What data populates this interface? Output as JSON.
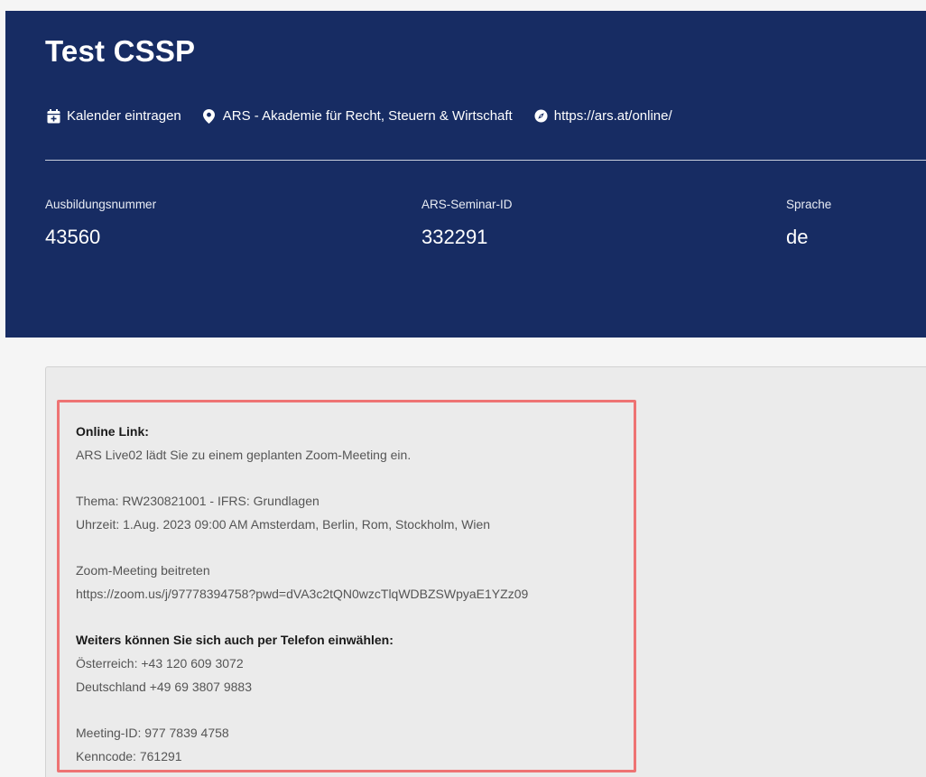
{
  "header": {
    "title": "Test CSSP",
    "calendar_label": "Kalender eintragen",
    "location_label": "ARS - Akademie für Recht, Steuern & Wirtschaft",
    "url_label": "https://ars.at/online/",
    "fields": [
      {
        "label": "Ausbildungsnummer",
        "value": "43560"
      },
      {
        "label": "ARS-Seminar-ID",
        "value": "332291"
      },
      {
        "label": "Sprache",
        "value": "de"
      }
    ],
    "colors": {
      "background": "#172c63",
      "text": "#ffffff"
    }
  },
  "info": {
    "online_link_heading": "Online Link:",
    "invite_line": "ARS Live02 lädt Sie zu einem geplanten Zoom-Meeting ein.",
    "topic_line": "Thema: RW230821001 - IFRS: Grundlagen",
    "time_line": "Uhrzeit: 1.Aug. 2023 09:00 AM Amsterdam, Berlin, Rom, Stockholm, Wien",
    "join_label": "Zoom-Meeting beitreten",
    "join_url": "https://zoom.us/j/97778394758?pwd=dVA3c2tQN0wzcTlqWDBZSWpyaE1YZz09",
    "phone_heading": "Weiters können Sie sich auch per Telefon einwählen:",
    "phone_at": "Österreich: +43 120 609 3072",
    "phone_de": "Deutschland +49 69 3807 9883",
    "meeting_id": "Meeting-ID: 977 7839 4758",
    "passcode": "Kenncode: 761291"
  },
  "colors": {
    "highlight_border": "#ee7373",
    "content_bg": "#ebebeb"
  }
}
